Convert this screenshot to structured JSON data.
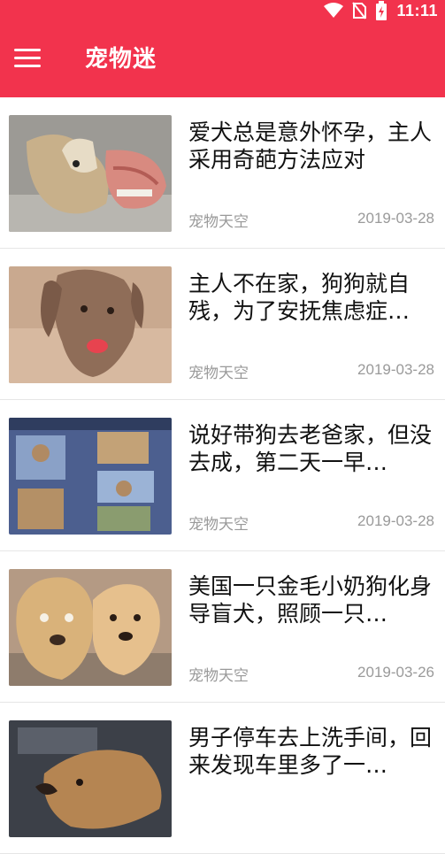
{
  "status_bar": {
    "time": "11:11",
    "icons": [
      "wifi-icon",
      "no-sim-icon",
      "battery-charging-icon"
    ]
  },
  "app_bar": {
    "title": "宠物迷",
    "menu_icon": "menu-icon",
    "color": "#f2334d"
  },
  "articles": [
    {
      "title": "爱犬总是意外怀孕，主人采用奇葩方法应对",
      "source": "宠物天空",
      "date": "2019-03-28"
    },
    {
      "title": "主人不在家，狗狗就自残，为了安抚焦虑症…",
      "source": "宠物天空",
      "date": "2019-03-28"
    },
    {
      "title": "说好带狗去老爸家，但没去成，第二天一早…",
      "source": "宠物天空",
      "date": "2019-03-28"
    },
    {
      "title": "美国一只金毛小奶狗化身导盲犬，照顾一只…",
      "source": "宠物天空",
      "date": "2019-03-26"
    },
    {
      "title": "男子停车去上洗手间，回来发现车里多了一…",
      "source": "",
      "date": ""
    }
  ]
}
